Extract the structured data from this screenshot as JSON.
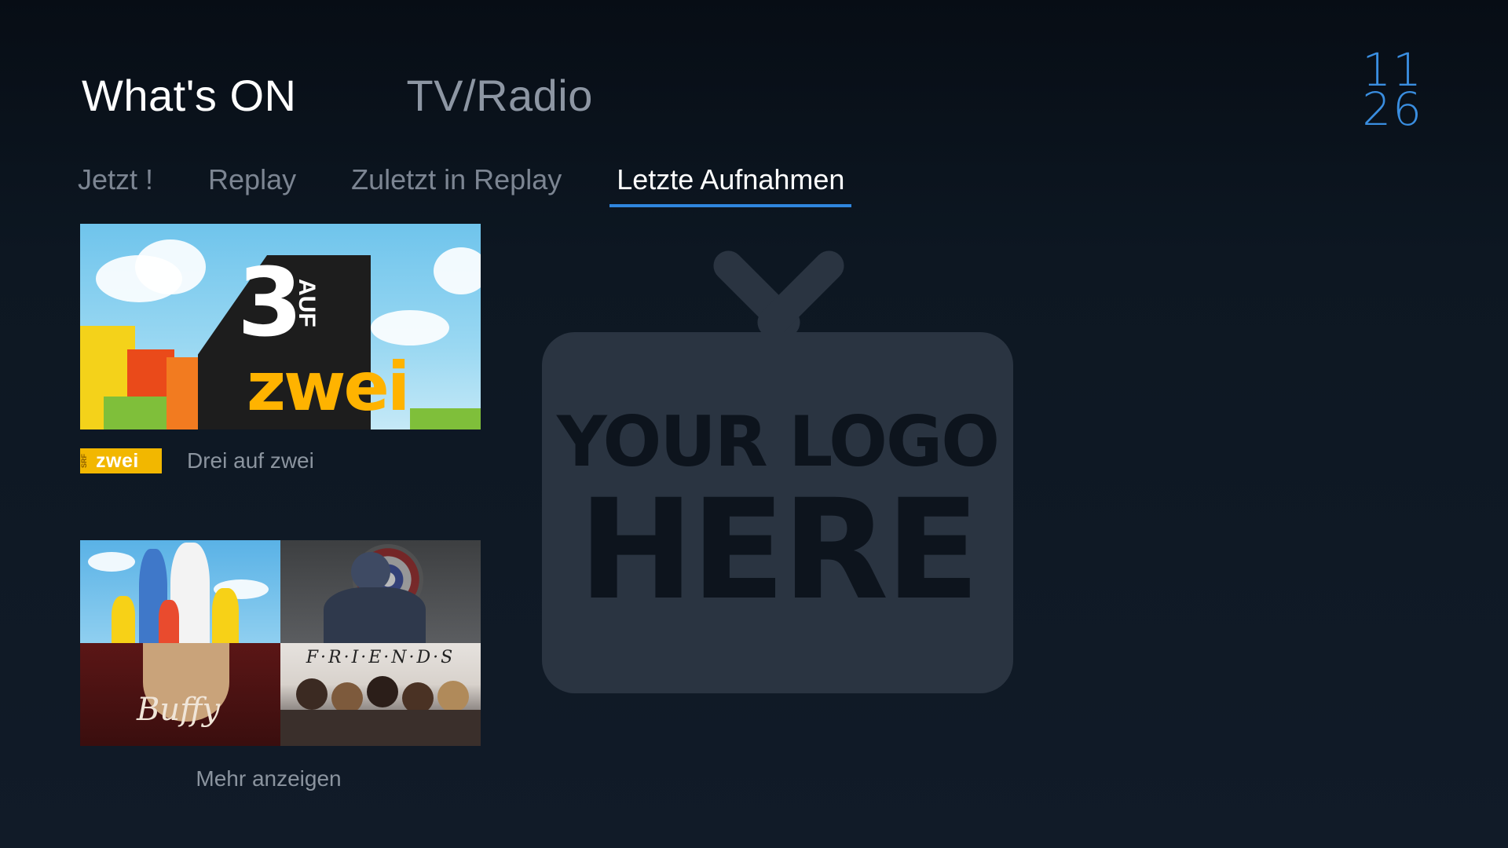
{
  "header": {
    "items": [
      {
        "label": "What's ON",
        "active": true
      },
      {
        "label": "TV/Radio",
        "active": false
      }
    ]
  },
  "clock": {
    "hours": "11",
    "minutes": "26",
    "color": "#3a8ee0"
  },
  "tabs": [
    {
      "label": "Jetzt !",
      "active": false
    },
    {
      "label": "Replay",
      "active": false
    },
    {
      "label": "Zuletzt in Replay",
      "active": false
    },
    {
      "label": "Letzte Aufnahmen",
      "active": true
    }
  ],
  "accent_color": "#2f86de",
  "recordings": {
    "item1": {
      "channel_logo_text": "zwei",
      "channel_logo_small": "SRF",
      "title": "Drei auf zwei",
      "artwork_number": "3",
      "artwork_auf": "AUF",
      "artwork_zwei": "zwei"
    },
    "more": {
      "label": "Mehr anzeigen",
      "friends_title": "F·R·I·E·N·D·S",
      "buffy_title": "Buffy"
    }
  },
  "placeholder": {
    "line1": "YOUR LOGO",
    "line2": "HERE"
  }
}
